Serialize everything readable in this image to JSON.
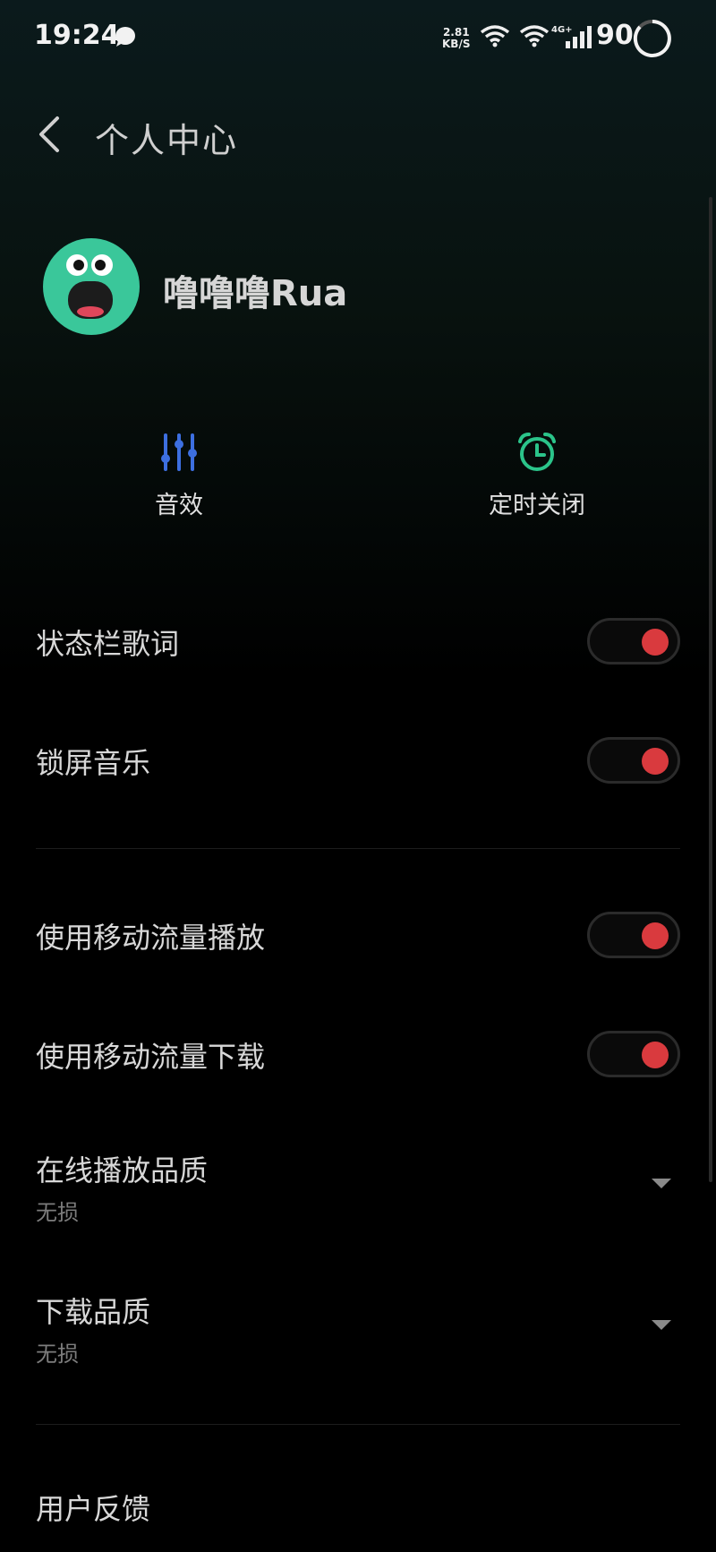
{
  "status_bar": {
    "time": "19:24",
    "net_speed_value": "2.81",
    "net_speed_unit": "KB/S",
    "network_type": "4G+",
    "battery": "90"
  },
  "header": {
    "title": "个人中心"
  },
  "profile": {
    "username": "噜噜噜Rua"
  },
  "quick_actions": {
    "equalizer_label": "音效",
    "timer_label": "定时关闭"
  },
  "settings": {
    "status_bar_lyrics": {
      "label": "状态栏歌词",
      "enabled": true
    },
    "lock_screen_music": {
      "label": "锁屏音乐",
      "enabled": true
    },
    "mobile_data_play": {
      "label": "使用移动流量播放",
      "enabled": true
    },
    "mobile_data_download": {
      "label": "使用移动流量下载",
      "enabled": true
    },
    "online_quality": {
      "label": "在线播放品质",
      "value": "无损"
    },
    "download_quality": {
      "label": "下载品质",
      "value": "无损"
    },
    "feedback": {
      "label": "用户反馈"
    }
  },
  "colors": {
    "accent_toggle": "#d93a3e",
    "equalizer_icon": "#3d6fe0",
    "timer_icon": "#2bc48a",
    "avatar_bg": "#3ac79a"
  }
}
